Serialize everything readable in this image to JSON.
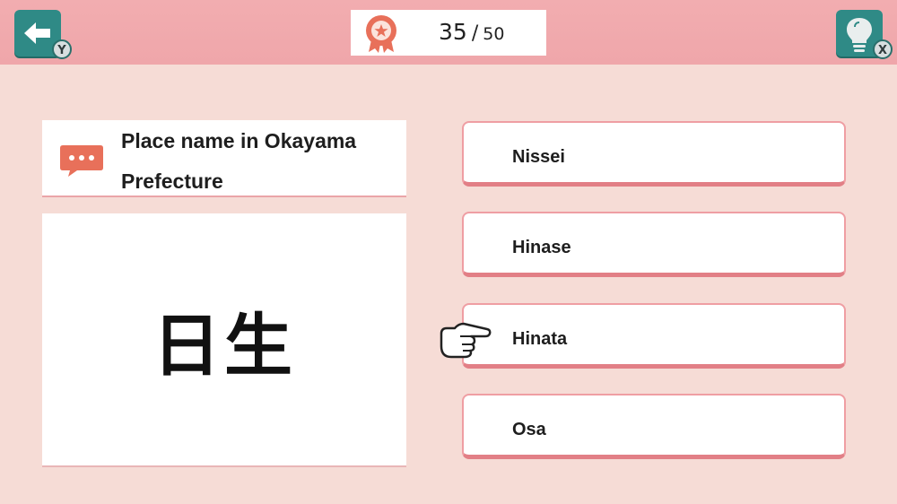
{
  "header": {
    "back_key": "Y",
    "hint_key": "X",
    "score": {
      "current": "35",
      "separator": "/",
      "total": "50"
    }
  },
  "question": {
    "prompt": "Place name in Okayama Prefecture",
    "kanji": "日生"
  },
  "answers": [
    {
      "label": "Nissei"
    },
    {
      "label": "Hinase"
    },
    {
      "label": "Hinata"
    },
    {
      "label": "Osa"
    }
  ],
  "selected_answer_index": 2,
  "colors": {
    "background": "#f6dcd6",
    "topbar": "#f2adb0",
    "button_teal": "#2f8a86",
    "accent_orange": "#e8705a",
    "answer_border": "#ef9ea3"
  },
  "icons": {
    "back": "back-arrow-icon",
    "hint": "lightbulb-icon",
    "score": "award-ribbon-icon",
    "question": "speech-bubble-icon",
    "cursor": "pointing-hand-icon"
  }
}
